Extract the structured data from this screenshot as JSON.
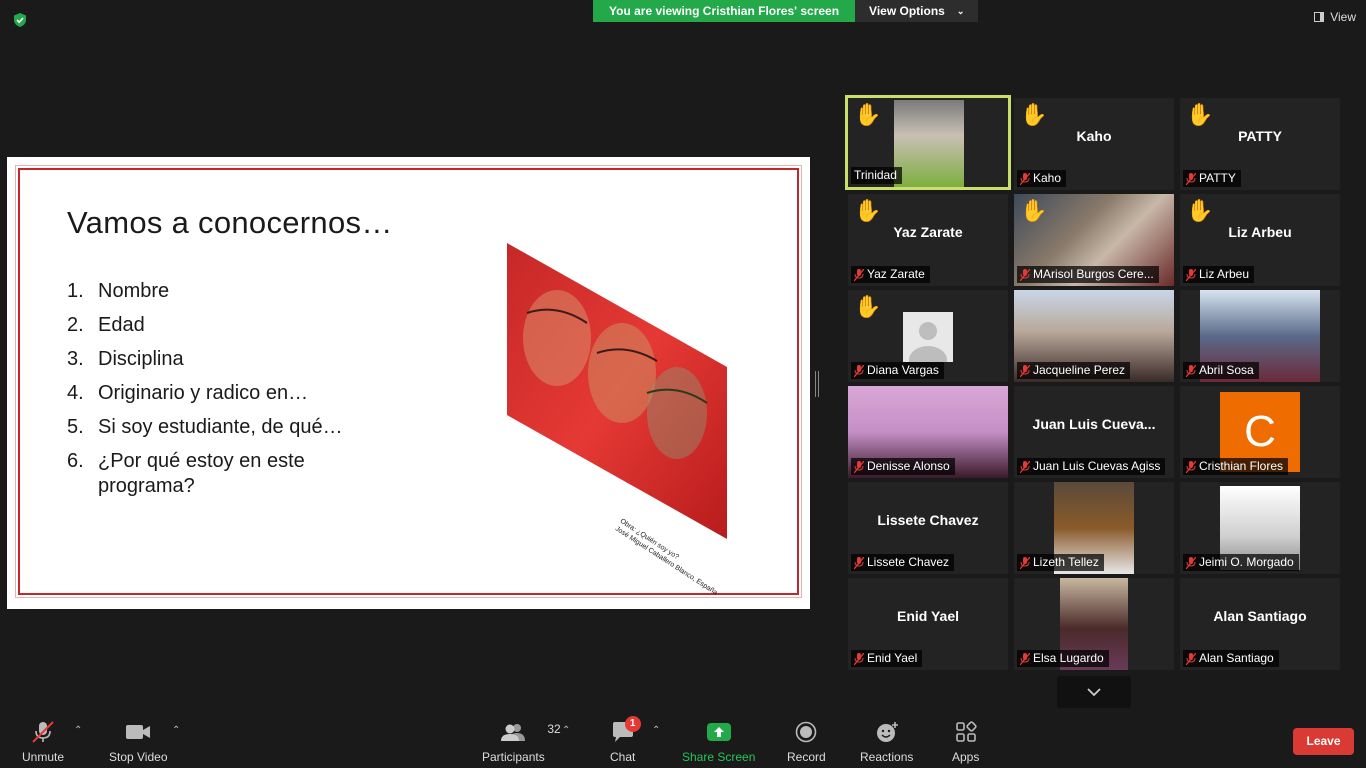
{
  "banner": {
    "viewing": "You are viewing Cristhian Flores' screen",
    "options": "View Options"
  },
  "view_button": "View",
  "slide": {
    "title": "Vamos a conocernos…",
    "items": [
      {
        "n": "1.",
        "text": "Nombre"
      },
      {
        "n": "2.",
        "text": "Edad"
      },
      {
        "n": "3.",
        "text": "Disciplina"
      },
      {
        "n": "4.",
        "text": "Originario y radico en…"
      },
      {
        "n": "5.",
        "text": "Si soy estudiante, de qué…"
      },
      {
        "n": "6.",
        "text": "¿Por qué estoy en este programa?"
      }
    ],
    "caption_line1": "Obra: ¿Quién soy yo?",
    "caption_line2": "José Miguel Caballero Blanco, España"
  },
  "participants": [
    {
      "label": "Trinidad",
      "center": "",
      "muted": false,
      "hand": "✋",
      "active": true
    },
    {
      "label": "Kaho",
      "center": "Kaho",
      "muted": true,
      "hand": "✋"
    },
    {
      "label": "PATTY",
      "center": "PATTY",
      "muted": true,
      "hand": "✋"
    },
    {
      "label": "Yaz Zarate",
      "center": "Yaz Zarate",
      "muted": true,
      "hand": "✋"
    },
    {
      "label": "MArisol Burgos Cere...",
      "center": "",
      "muted": true,
      "hand": "✋"
    },
    {
      "label": "Liz Arbeu",
      "center": "Liz Arbeu",
      "muted": true,
      "hand": "✋"
    },
    {
      "label": "Diana Vargas",
      "center": "",
      "muted": true,
      "hand": "✋"
    },
    {
      "label": "Jacqueline Perez",
      "center": "",
      "muted": true,
      "hand": ""
    },
    {
      "label": "Abril Sosa",
      "center": "",
      "muted": true,
      "hand": ""
    },
    {
      "label": "Denisse Alonso",
      "center": "",
      "muted": true,
      "hand": ""
    },
    {
      "label": "Juan Luis Cuevas Agiss",
      "center": "Juan Luis Cueva...",
      "muted": true,
      "hand": ""
    },
    {
      "label": "Cristhian Flores",
      "center": "",
      "muted": true,
      "hand": ""
    },
    {
      "label": "Lissete Chavez",
      "center": "Lissete Chavez",
      "muted": true,
      "hand": ""
    },
    {
      "label": "Lizeth Tellez",
      "center": "",
      "muted": true,
      "hand": ""
    },
    {
      "label": "Jeimi O. Morgado",
      "center": "",
      "muted": true,
      "hand": ""
    },
    {
      "label": "Enid Yael",
      "center": "Enid Yael",
      "muted": true,
      "hand": ""
    },
    {
      "label": "Elsa Lugardo",
      "center": "",
      "muted": true,
      "hand": ""
    },
    {
      "label": "Alan Santiago",
      "center": "Alan Santiago",
      "muted": true,
      "hand": ""
    }
  ],
  "avatar_letter": "C",
  "toolbar": {
    "unmute": "Unmute",
    "stop_video": "Stop Video",
    "participants": "Participants",
    "participants_count": "32",
    "chat": "Chat",
    "chat_badge": "1",
    "share_screen": "Share Screen",
    "record": "Record",
    "reactions": "Reactions",
    "apps": "Apps",
    "leave": "Leave"
  },
  "colors": {
    "share_green": "#23a84a",
    "leave_red": "#d93a34",
    "active_border": "#c8e06a",
    "avatar_orange": "#ef6c00"
  }
}
